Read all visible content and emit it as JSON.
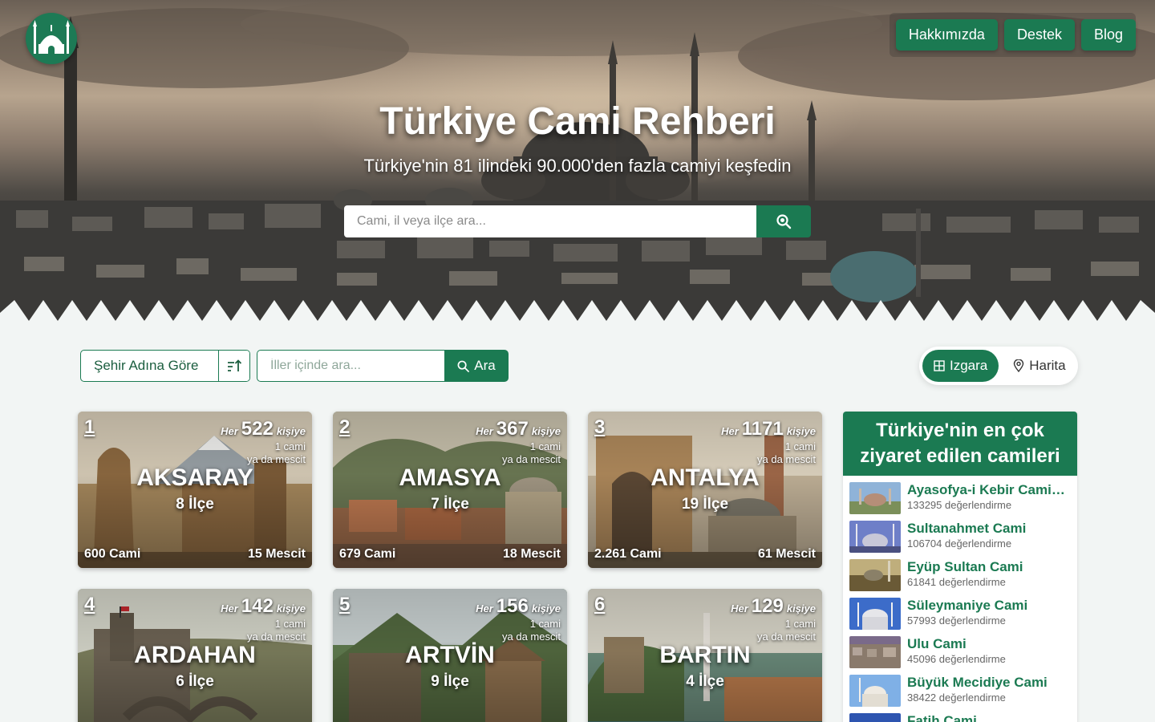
{
  "site": {
    "logo_icon": "mosque-icon",
    "nav": [
      "Hakkımızda",
      "Destek",
      "Blog"
    ]
  },
  "hero": {
    "title": "Türkiye Cami Rehberi",
    "subtitle": "Türkiye'nin 81 ilindeki 90.000'den fazla camiyi keşfedin",
    "search_placeholder": "Cami, il veya ilçe ara...",
    "search_icon": "search-icon"
  },
  "filters": {
    "sort_label": "Şehir Adına Göre",
    "sort_icon": "sort-icon",
    "city_search_placeholder": "İller içinde ara...",
    "city_search_button": "Ara",
    "view_grid": "Izgara",
    "view_map": "Harita"
  },
  "colors": {
    "primary": "#1b7a52",
    "background": "#f2f5f4"
  },
  "cards": [
    {
      "rank": "1",
      "per_prefix": "Her",
      "per_num": "522",
      "per_suffix": "kişiye",
      "per_line2": "1 cami",
      "per_line3": "ya da mescit",
      "name": "AKSARAY",
      "ilce": "8 İlçe",
      "cami": "600 Cami",
      "mescit": "15 Mescit"
    },
    {
      "rank": "2",
      "per_prefix": "Her",
      "per_num": "367",
      "per_suffix": "kişiye",
      "per_line2": "1 cami",
      "per_line3": "ya da mescit",
      "name": "AMASYA",
      "ilce": "7 İlçe",
      "cami": "679 Cami",
      "mescit": "18 Mescit"
    },
    {
      "rank": "3",
      "per_prefix": "Her",
      "per_num": "1171",
      "per_suffix": "kişiye",
      "per_line2": "1 cami",
      "per_line3": "ya da mescit",
      "name": "ANTALYA",
      "ilce": "19 İlçe",
      "cami": "2.261 Cami",
      "mescit": "61 Mescit"
    },
    {
      "rank": "4",
      "per_prefix": "Her",
      "per_num": "142",
      "per_suffix": "kişiye",
      "per_line2": "1 cami",
      "per_line3": "ya da mescit",
      "name": "ARDAHAN",
      "ilce": "6 İlçe",
      "cami": "",
      "mescit": ""
    },
    {
      "rank": "5",
      "per_prefix": "Her",
      "per_num": "156",
      "per_suffix": "kişiye",
      "per_line2": "1 cami",
      "per_line3": "ya da mescit",
      "name": "ARTVİN",
      "ilce": "9 İlçe",
      "cami": "",
      "mescit": ""
    },
    {
      "rank": "6",
      "per_prefix": "Her",
      "per_num": "129",
      "per_suffix": "kişiye",
      "per_line2": "1 cami",
      "per_line3": "ya da mescit",
      "name": "BARTIN",
      "ilce": "4 İlçe",
      "cami": "",
      "mescit": ""
    }
  ],
  "sidebar": {
    "title": "Türkiye'nin en çok ziyaret edilen camileri",
    "items": [
      {
        "name": "Ayasofya-i Kebir Cami-i Şerifi",
        "reviews": "133295 değerlendirme"
      },
      {
        "name": "Sultanahmet Cami",
        "reviews": "106704 değerlendirme"
      },
      {
        "name": "Eyüp Sultan Cami",
        "reviews": "61841 değerlendirme"
      },
      {
        "name": "Süleymaniye Cami",
        "reviews": "57993 değerlendirme"
      },
      {
        "name": "Ulu Cami",
        "reviews": "45096 değerlendirme"
      },
      {
        "name": "Büyük Mecidiye Cami",
        "reviews": "38422 değerlendirme"
      },
      {
        "name": "Fatih Cami",
        "reviews": ""
      }
    ]
  }
}
